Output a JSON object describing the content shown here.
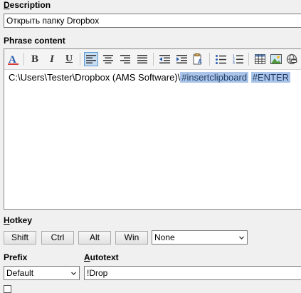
{
  "description": {
    "label": "Description",
    "underline": "D",
    "value": "Открыть папку Dropbox"
  },
  "phrase": {
    "label": "Phrase content",
    "content": {
      "path": "C:\\Users\\Tester\\Dropbox (AMS Software)\\",
      "macro1": "#insertclipboard",
      "macro2": "#ENTER"
    },
    "toolbar": [
      "font-color-icon",
      "bold-icon",
      "italic-icon",
      "underline-icon",
      "align-left-icon",
      "align-center-icon",
      "align-right-icon",
      "justify-icon",
      "outdent-icon",
      "indent-icon",
      "paste-special-icon",
      "bullet-list-icon",
      "numbered-list-icon",
      "table-icon",
      "image-icon",
      "link-icon"
    ]
  },
  "hotkey": {
    "label": "Hotkey",
    "underline": "H",
    "buttons": {
      "shift": "Shift",
      "ctrl": "Ctrl",
      "alt": "Alt",
      "win": "Win"
    },
    "key_value": "None"
  },
  "prefix": {
    "label": "Prefix",
    "value": "Default"
  },
  "autotext": {
    "label": "Autotext",
    "underline": "A",
    "value": "!Drop"
  },
  "colors": {
    "macro_highlight": "#a9c4e8",
    "active_button": "#c7ddf2"
  }
}
